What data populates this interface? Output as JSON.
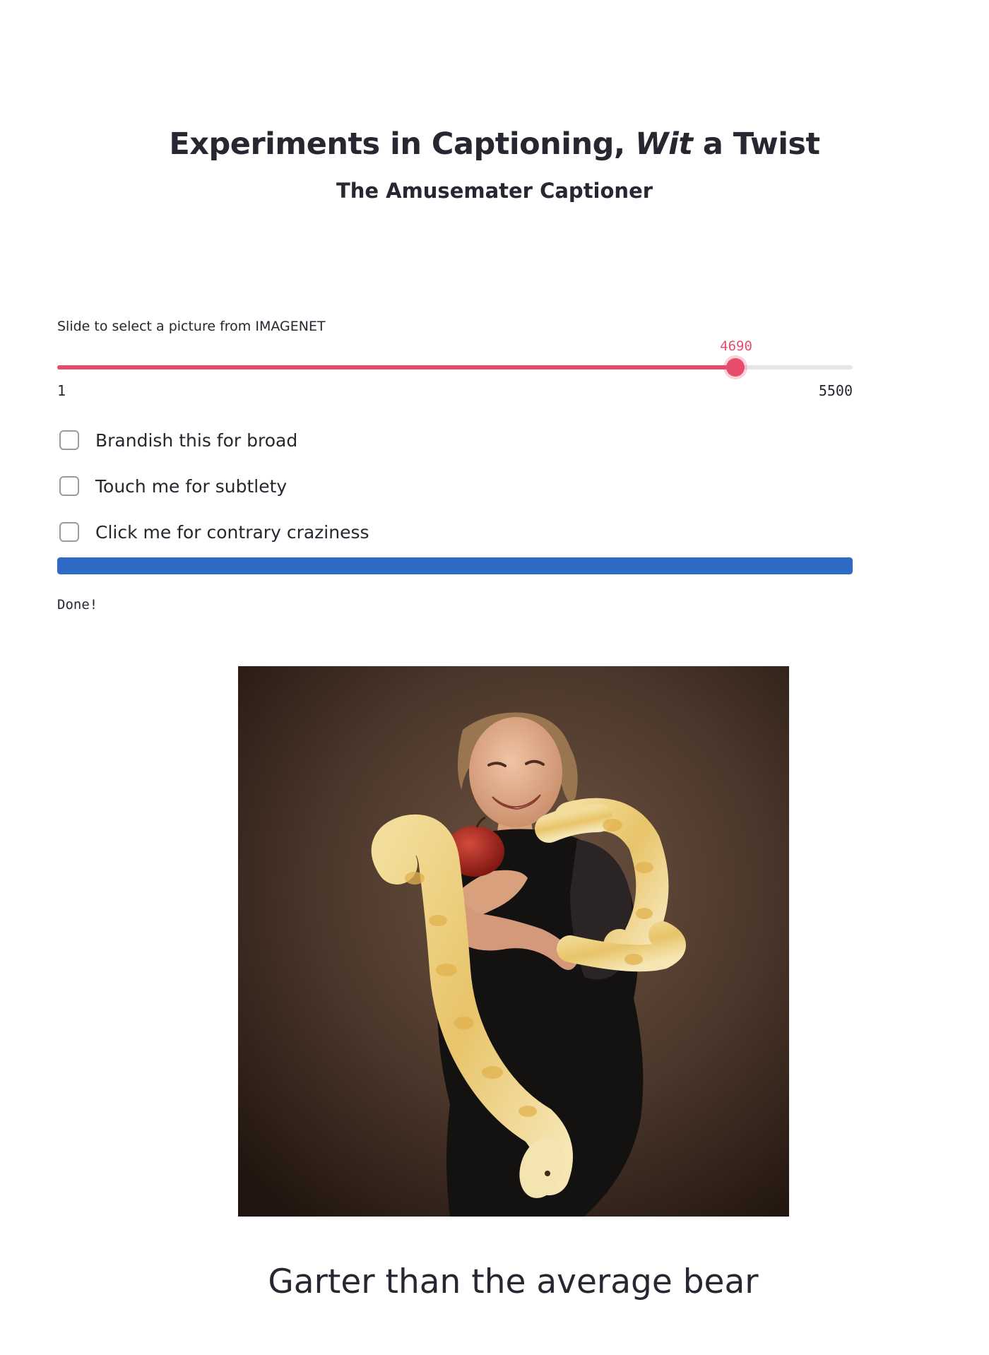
{
  "header": {
    "title_part1": "Experiments in Captioning, ",
    "title_emphasis": "Wit",
    "title_part2": " a Twist",
    "subtitle": "The Amusemater Captioner"
  },
  "slider": {
    "label": "Slide to select a picture from IMAGENET",
    "value": 4690,
    "value_text": "4690",
    "min": 1,
    "min_text": "1",
    "max": 5500,
    "max_text": "5500",
    "accent_color": "#e84c6b"
  },
  "checkboxes": [
    {
      "label": "Brandish this for broad",
      "checked": false
    },
    {
      "label": "Touch me for subtlety",
      "checked": true
    },
    {
      "label": "Click me for contrary craziness",
      "checked": false
    }
  ],
  "progress": {
    "fraction": 1.0,
    "color": "#2d6bc6",
    "status_text": "Done!"
  },
  "image": {
    "icon": "photo-woman-with-python-and-apple"
  },
  "caption": "Garter than the average bear"
}
